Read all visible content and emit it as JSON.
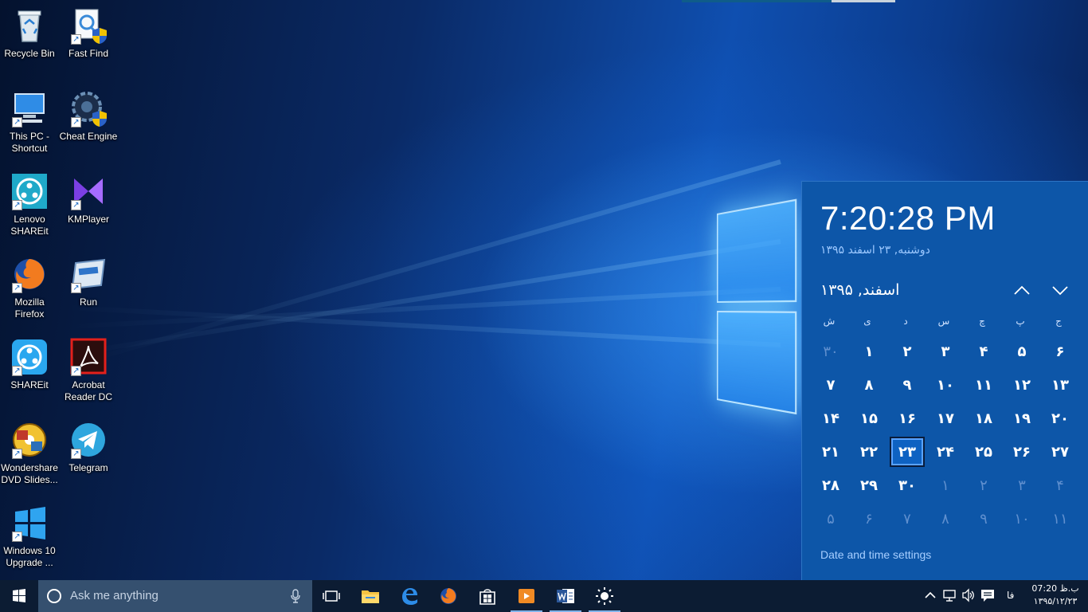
{
  "desktop": {
    "icons": [
      {
        "label": "Recycle Bin",
        "icon": "recycle-bin-icon"
      },
      {
        "label": "Fast Find",
        "icon": "fast-find-icon"
      },
      {
        "label": "This PC - Shortcut",
        "icon": "computer-icon"
      },
      {
        "label": "Cheat Engine",
        "icon": "cheat-engine-icon"
      },
      {
        "label": "Lenovo SHAREit",
        "icon": "lenovo-shareit-icon"
      },
      {
        "label": "KMPlayer",
        "icon": "kmplayer-icon"
      },
      {
        "label": "Mozilla Firefox",
        "icon": "firefox-icon"
      },
      {
        "label": "Run",
        "icon": "run-icon"
      },
      {
        "label": "SHAREit",
        "icon": "shareit-icon"
      },
      {
        "label": "Acrobat Reader DC",
        "icon": "acrobat-icon"
      },
      {
        "label": "Wondershare DVD Slides...",
        "icon": "wondershare-icon"
      },
      {
        "label": "Telegram",
        "icon": "telegram-icon"
      },
      {
        "label": "Windows 10 Upgrade ...",
        "icon": "windows-upgrade-icon"
      }
    ]
  },
  "flyout": {
    "time": "7:20:28 PM",
    "long_date": "دوشنبه, ۲۳ اسفند ۱۳۹۵",
    "month_title": "اسفند, ۱۳۹۵",
    "weekdays": [
      "ش",
      "ی",
      "د",
      "س",
      "چ",
      "پ",
      "ج"
    ],
    "days": [
      {
        "label": "۳۰",
        "dim": true
      },
      {
        "label": "۱"
      },
      {
        "label": "۲"
      },
      {
        "label": "۳"
      },
      {
        "label": "۴"
      },
      {
        "label": "۵"
      },
      {
        "label": "۶"
      },
      {
        "label": "۷"
      },
      {
        "label": "۸"
      },
      {
        "label": "۹"
      },
      {
        "label": "۱۰"
      },
      {
        "label": "۱۱"
      },
      {
        "label": "۱۲"
      },
      {
        "label": "۱۳"
      },
      {
        "label": "۱۴"
      },
      {
        "label": "۱۵"
      },
      {
        "label": "۱۶"
      },
      {
        "label": "۱۷"
      },
      {
        "label": "۱۸"
      },
      {
        "label": "۱۹"
      },
      {
        "label": "۲۰"
      },
      {
        "label": "۲۱"
      },
      {
        "label": "۲۲"
      },
      {
        "label": "۲۳",
        "today": true
      },
      {
        "label": "۲۴"
      },
      {
        "label": "۲۵"
      },
      {
        "label": "۲۶"
      },
      {
        "label": "۲۷"
      },
      {
        "label": "۲۸"
      },
      {
        "label": "۲۹"
      },
      {
        "label": "۳۰"
      },
      {
        "label": "۱",
        "dim": true
      },
      {
        "label": "۲",
        "dim": true
      },
      {
        "label": "۳",
        "dim": true
      },
      {
        "label": "۴",
        "dim": true
      },
      {
        "label": "۵",
        "dim": true
      },
      {
        "label": "۶",
        "dim": true
      },
      {
        "label": "۷",
        "dim": true
      },
      {
        "label": "۸",
        "dim": true
      },
      {
        "label": "۹",
        "dim": true
      },
      {
        "label": "۱۰",
        "dim": true
      },
      {
        "label": "۱۱",
        "dim": true
      }
    ],
    "settings_link": "Date and time settings"
  },
  "taskbar": {
    "search_placeholder": "Ask me anything",
    "apps": [
      "task-view-icon",
      "file-explorer-icon",
      "edge-icon",
      "firefox-icon",
      "store-icon",
      "media-player-icon",
      "word-icon",
      "brightness-icon"
    ],
    "language": "فا",
    "tray_time": "ب.ظ 07:20",
    "tray_date": "۱۳۹۵/۱۲/۲۳"
  },
  "colors": {
    "accent": "#0d56a8",
    "taskbar": "#0c1c33",
    "search_box": "#35506f",
    "dim_day": "#5f8fce"
  }
}
